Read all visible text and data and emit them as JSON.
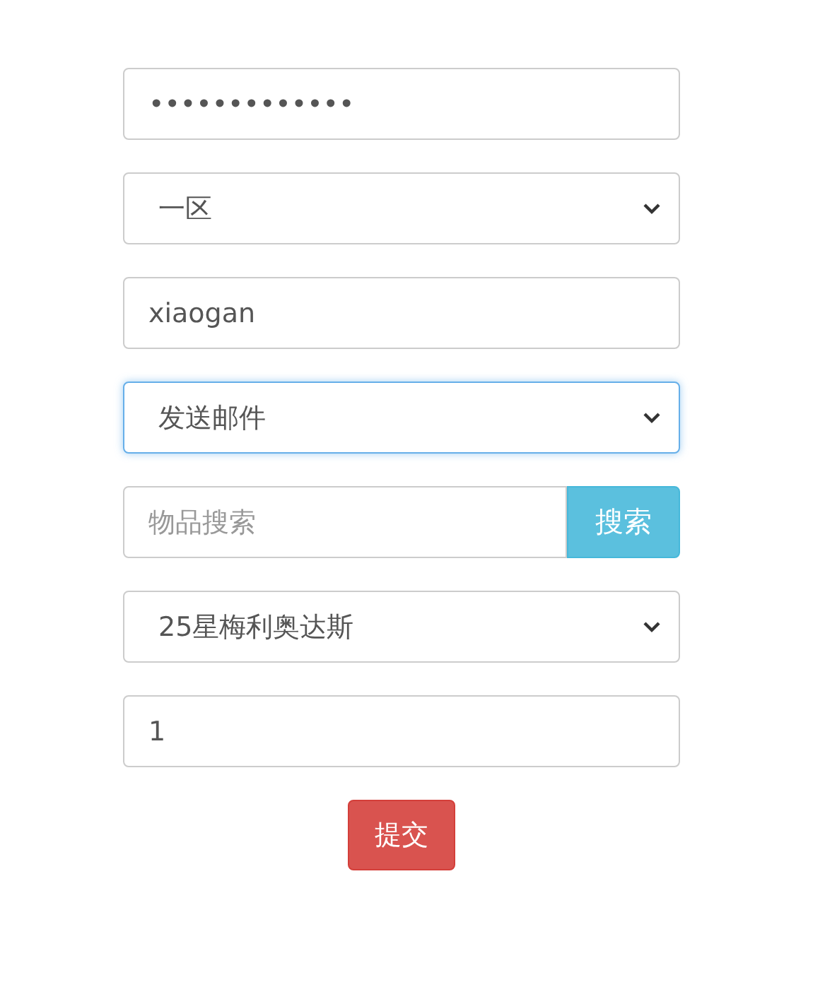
{
  "form": {
    "fields": [
      {
        "kind": "input",
        "value": "•••••••••••••",
        "focused": false
      },
      {
        "kind": "select",
        "value": "一区",
        "focused": false
      },
      {
        "kind": "input",
        "value": "xiaogan",
        "focused": false
      },
      {
        "kind": "select",
        "value": "发送邮件",
        "focused": true
      },
      {
        "kind": "search",
        "placeholder": "物品搜索",
        "button": "搜索",
        "focused": false
      },
      {
        "kind": "select",
        "value": "25星梅利奥达斯",
        "focused": false
      },
      {
        "kind": "input",
        "value": "1",
        "focused": false
      }
    ],
    "submit": "提交"
  }
}
